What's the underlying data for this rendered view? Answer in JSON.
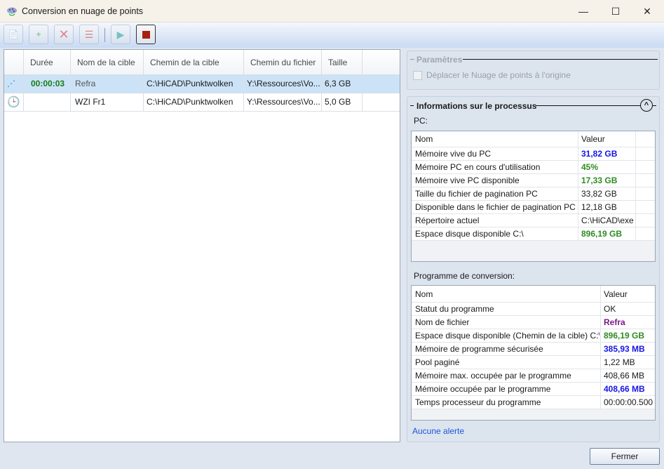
{
  "window": {
    "title": "Conversion en nuage de points",
    "minimize": "—",
    "maximize": "☐",
    "close": "✕"
  },
  "toolbar": {
    "buttons": [
      "add-file",
      "add-folder",
      "delete",
      "delete-all",
      "start",
      "stop"
    ]
  },
  "jobs": {
    "columns": [
      "",
      "Durée",
      "Nom de la cible",
      "Chemin de la cible",
      "Chemin du fichier",
      "Taille"
    ],
    "rows": [
      {
        "status": "running",
        "duration": "00:00:03",
        "target": "Refra",
        "target_path": "C:\\HiCAD\\Punktwolken",
        "file_path": "Y:\\Ressources\\Vo...",
        "size": "6,3 GB"
      },
      {
        "status": "waiting",
        "duration": "",
        "target": "WZI Fr1",
        "target_path": "C:\\HiCAD\\Punktwolken",
        "file_path": "Y:\\Ressources\\Vo...",
        "size": "5,0 GB"
      }
    ]
  },
  "params": {
    "title": "Paramètres",
    "move_origin": "Déplacer le Nuage de points à l'origine",
    "move_origin_checked": false
  },
  "info": {
    "title": "Informations sur le processus",
    "pc_label": "PC:",
    "pc_columns": [
      "Nom",
      "Valeur"
    ],
    "pc_rows": [
      {
        "name": "Mémoire vive du PC",
        "value": "31,82 GB",
        "color": "blue"
      },
      {
        "name": "Mémoire PC en cours d'utilisation",
        "value": "45%",
        "color": "green"
      },
      {
        "name": "Mémoire vive PC disponible",
        "value": "17,33 GB",
        "color": "green"
      },
      {
        "name": "Taille du fichier de pagination PC",
        "value": "33,82 GB",
        "color": ""
      },
      {
        "name": "Disponible dans le fichier de pagination PC",
        "value": "12,18 GB",
        "color": ""
      },
      {
        "name": "Répertoire actuel",
        "value": "C:\\HiCAD\\exe",
        "color": ""
      },
      {
        "name": "Espace disque disponible C:\\",
        "value": "896,19 GB",
        "color": "green"
      }
    ],
    "prog_label": "Programme de conversion:",
    "prog_columns": [
      "Nom",
      "Valeur"
    ],
    "prog_rows": [
      {
        "name": "Statut du programme",
        "value": "OK",
        "color": ""
      },
      {
        "name": "Nom de fichier",
        "value": "Refra",
        "color": "purple"
      },
      {
        "name": "Espace disque disponible (Chemin de la cible) C:\\",
        "value": "896,19 GB",
        "color": "green"
      },
      {
        "name": "Mémoire de programme sécurisée",
        "value": "385,93 MB",
        "color": "blue"
      },
      {
        "name": "Pool paginé",
        "value": "1,22 MB",
        "color": ""
      },
      {
        "name": "Mémoire max. occupée par le programme",
        "value": "408,66 MB",
        "color": ""
      },
      {
        "name": "Mémoire occupée par le programme",
        "value": "408,66 MB",
        "color": "blue"
      },
      {
        "name": "Temps processeur du programme",
        "value": "00:00:00.500",
        "color": ""
      }
    ],
    "alerts": "Aucune alerte"
  },
  "footer": {
    "close": "Fermer"
  }
}
